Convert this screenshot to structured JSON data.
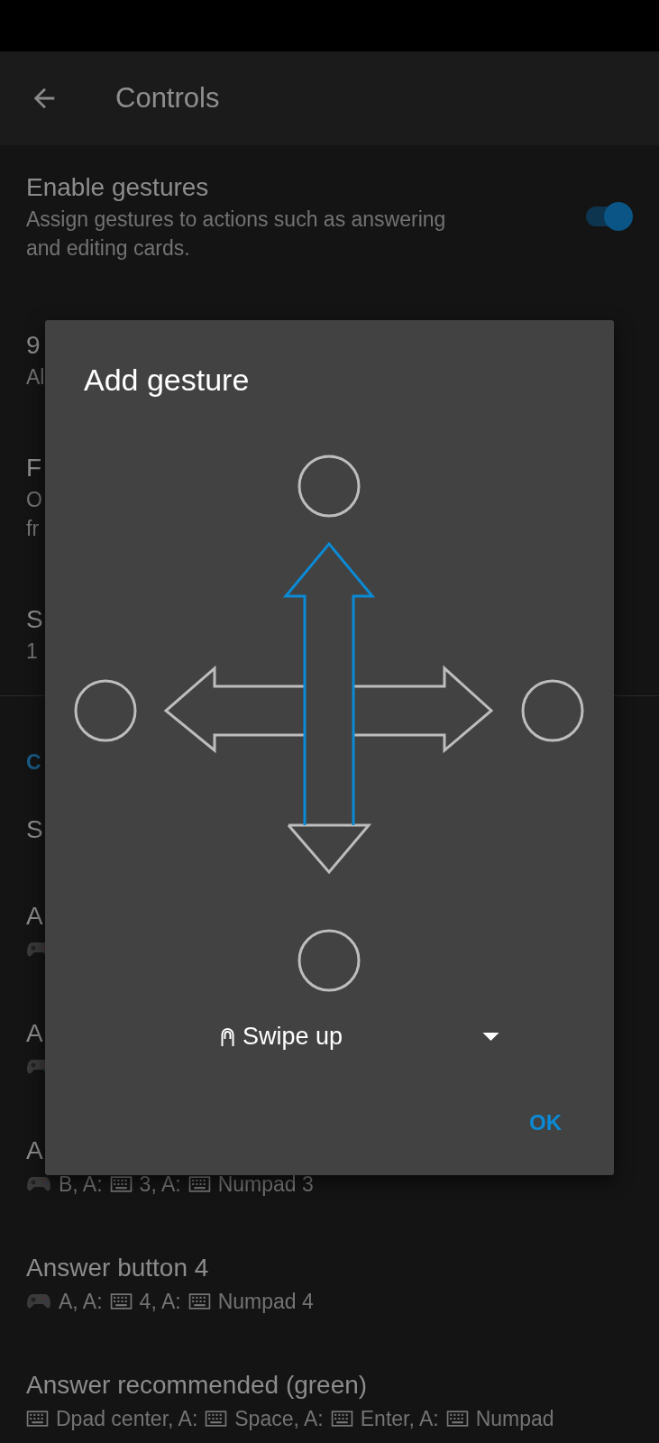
{
  "app_bar": {
    "title": "Controls"
  },
  "settings": [
    {
      "kind": "switch",
      "title": "Enable gestures",
      "subtitle_lines": [
        "Assign gestures to actions such as answering",
        "and editing cards."
      ],
      "checked": true
    },
    {
      "kind": "text",
      "title": "9",
      "subtitle_lines": [
        "Al"
      ]
    },
    {
      "kind": "text",
      "title": "F",
      "subtitle_lines": [
        "O",
        "fr"
      ]
    },
    {
      "kind": "text",
      "title": "S",
      "subtitle_lines": [
        "1"
      ]
    },
    {
      "kind": "category",
      "title": "C"
    },
    {
      "kind": "title",
      "title": "S"
    },
    {
      "kind": "bindings",
      "title": "A",
      "bindings": [
        {
          "kind": "gamepad"
        }
      ]
    },
    {
      "kind": "bindings",
      "title": "A",
      "bindings": [
        {
          "kind": "gamepad"
        }
      ]
    },
    {
      "kind": "bindings",
      "title": "A",
      "bindings": [
        {
          "kind": "gamepad",
          "text": "B, A:"
        },
        {
          "kind": "keyboard",
          "text": "3, A:"
        },
        {
          "kind": "keyboard",
          "text": "Numpad 3"
        }
      ]
    },
    {
      "kind": "bindings",
      "title": "Answer button 4",
      "bindings": [
        {
          "kind": "gamepad",
          "text": "A, A:"
        },
        {
          "kind": "keyboard",
          "text": "4, A:"
        },
        {
          "kind": "keyboard",
          "text": "Numpad 4"
        }
      ]
    },
    {
      "kind": "bindings",
      "title": "Answer recommended (green)",
      "bindings": [
        {
          "kind": "keyboard",
          "text": "Dpad center, A:"
        },
        {
          "kind": "keyboard",
          "text": "Space, A:"
        },
        {
          "kind": "keyboard",
          "text": "Enter, A:"
        },
        {
          "kind": "keyboard",
          "text": "Numpad"
        }
      ]
    }
  ],
  "dialog": {
    "title": "Add gesture",
    "arrows": [
      {
        "kind": "left",
        "selected": false
      },
      {
        "kind": "right",
        "selected": false
      },
      {
        "kind": "down",
        "selected": false
      },
      {
        "kind": "up",
        "selected": true
      }
    ],
    "gesture": "Swipe up",
    "buttons": [
      "OK"
    ]
  }
}
